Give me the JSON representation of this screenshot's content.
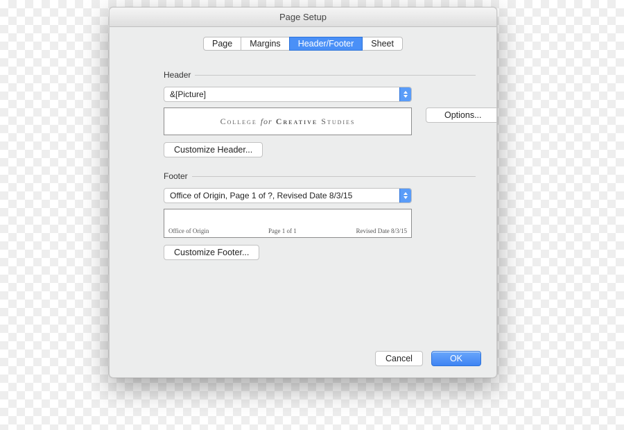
{
  "title": "Page Setup",
  "tabs": {
    "page": "Page",
    "margins": "Margins",
    "headerfooter": "Header/Footer",
    "sheet": "Sheet"
  },
  "header": {
    "label": "Header",
    "selected": "&[Picture]",
    "preview_brand_1": "College",
    "preview_brand_for": "for",
    "preview_brand_2": "Creative",
    "preview_brand_3": "Studies",
    "customize": "Customize Header..."
  },
  "options": "Options...",
  "footer": {
    "label": "Footer",
    "selected": "Office of Origin, Page 1 of ?, Revised  Date 8/3/15",
    "preview_left": "Office of Origin",
    "preview_center": "Page 1 of 1",
    "preview_right": "Revised  Date 8/3/15",
    "customize": "Customize Footer..."
  },
  "buttons": {
    "cancel": "Cancel",
    "ok": "OK"
  }
}
